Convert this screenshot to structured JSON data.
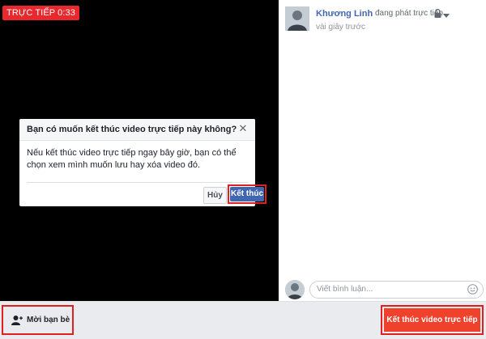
{
  "video": {
    "live_badge": "TRỰC TIẾP 0:33"
  },
  "dialog": {
    "title": "Bạn có muốn kết thúc video trực tiếp này không?",
    "close_icon": "close-icon",
    "body": "Nếu kết thúc video trực tiếp ngay bây giờ, bạn có thể chọn xem mình muốn lưu hay xóa video đó.",
    "cancel_label": "Hủy",
    "confirm_label": "Kết thúc"
  },
  "sidebar": {
    "author_name": "Khương Linh",
    "status": "đang phát trực tiếp.",
    "time": "vài giây trước",
    "privacy_icon": "lock-icon",
    "menu_icon": "chevron-down-icon",
    "comment_placeholder": "Viết bình luận...",
    "emoji_icon": "emoji-icon"
  },
  "bottom_bar": {
    "invite_label": "Mời bạn bè",
    "invite_icon": "add-friend-icon",
    "end_live_label": "Kết thúc video trực tiếp"
  },
  "colors": {
    "live_red": "#e9282e",
    "primary_blue": "#4267b2",
    "end_button_red": "#f0412d",
    "highlight_red": "#e02020"
  }
}
